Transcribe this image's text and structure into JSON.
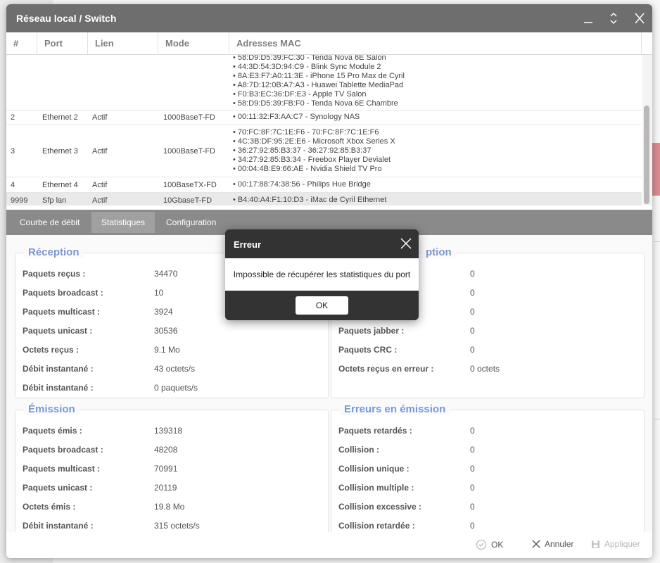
{
  "window": {
    "title": "Réseau local / Switch"
  },
  "table": {
    "columns": [
      "#",
      "Port",
      "Lien",
      "Mode",
      "Adresses MAC"
    ],
    "rows": [
      {
        "id": "",
        "port": "",
        "link": "",
        "mode": "",
        "macs": [
          "58:D9:D5:39:FC:30 - Tenda Nova 6E Salon",
          "44:3D:54:3D:94:C9 - Blink Sync Module 2",
          "8A:E3:F7:A0:11:3E - iPhone 15 Pro Max de Cyril",
          "A8:7D:12:0B:A7:A3 - Huawei Tablette MediaPad",
          "F0:B3:EC:36:DF:E3 - Apple TV Salon",
          "58:D9:D5:39:FB:F0 - Tenda Nova 6E Chambre"
        ]
      },
      {
        "id": "2",
        "port": "Ethernet 2",
        "link": "Actif",
        "mode": "1000BaseT-FD",
        "macs": [
          "00:11:32:F3:AA:C7 - Synology NAS"
        ]
      },
      {
        "id": "3",
        "port": "Ethernet 3",
        "link": "Actif",
        "mode": "1000BaseT-FD",
        "macs": [
          "70:FC:8F:7C:1E:F6 - 70:FC:8F:7C:1E:F6",
          "4C:3B:DF:95:2E:E6 - Microsoft Xbox Series X",
          "36:27:92:85:B3:37 - 36:27:92:85:B3:37",
          "34:27:92:85:B3:34 - Freebox Player Devialet",
          "00:04:4B:E9:66:AE - Nvidia Shield TV Pro"
        ]
      },
      {
        "id": "4",
        "port": "Ethernet 4",
        "link": "Actif",
        "mode": "100BaseTX-FD",
        "macs": [
          "00:17:88:74:38:56 - Philips Hue Bridge"
        ]
      },
      {
        "id": "9999",
        "port": "Sfp lan",
        "link": "Actif",
        "mode": "10GbaseT-FD",
        "macs": [
          "B4:40:A4:F1:10:D3 - iMac de Cyril Ethernet"
        ]
      }
    ]
  },
  "tabs": [
    "Courbe de débit",
    "Statistiques",
    "Configuration"
  ],
  "reception": {
    "title": "Réception",
    "rows": [
      {
        "k": "Paquets reçus :",
        "v": "34470"
      },
      {
        "k": "Paquets broadcast :",
        "v": "10"
      },
      {
        "k": "Paquets multicast :",
        "v": "3924"
      },
      {
        "k": "Paquets unicast :",
        "v": "30536"
      },
      {
        "k": "Octets reçus :",
        "v": "9.1 Mo"
      },
      {
        "k": "Débit instantané :",
        "v": "43 octets/s"
      },
      {
        "k": "Débit instantané :",
        "v": "0 paquets/s"
      }
    ]
  },
  "reception_errors": {
    "title_visible": "ption",
    "rows": [
      {
        "k": "",
        "v": "0"
      },
      {
        "k": "",
        "v": "0"
      },
      {
        "k": "",
        "v": "0"
      },
      {
        "k": "Paquets jabber :",
        "v": "0"
      },
      {
        "k": "Paquets CRC :",
        "v": "0"
      },
      {
        "k": "Octets reçus en erreur :",
        "v": "0 octets"
      }
    ]
  },
  "emission": {
    "title": "Émission",
    "rows": [
      {
        "k": "Paquets émis :",
        "v": "139318"
      },
      {
        "k": "Paquets broadcast :",
        "v": "48208"
      },
      {
        "k": "Paquets multicast :",
        "v": "70991"
      },
      {
        "k": "Paquets unicast :",
        "v": "20119"
      },
      {
        "k": "Octets émis :",
        "v": "19.8 Mo"
      },
      {
        "k": "Débit instantané :",
        "v": "315 octets/s"
      }
    ]
  },
  "emission_errors": {
    "title": "Erreurs en émission",
    "rows": [
      {
        "k": "Paquets retardés :",
        "v": "0"
      },
      {
        "k": "Collision :",
        "v": "0"
      },
      {
        "k": "Collision unique :",
        "v": "0"
      },
      {
        "k": "Collision multiple :",
        "v": "0"
      },
      {
        "k": "Collision excessive :",
        "v": "0"
      },
      {
        "k": "Collision retardée :",
        "v": "0"
      }
    ]
  },
  "footer": {
    "ok": "OK",
    "cancel": "Annuler",
    "apply": "Appliquer"
  },
  "dialog": {
    "title": "Erreur",
    "message": "Impossible de récupérer les statistiques du port",
    "ok": "OK"
  },
  "colors": {
    "titlebar": "#6e6e6e",
    "legend": "#7d97d1",
    "dialog": "#333333",
    "tabs": "#8a8a8a"
  }
}
